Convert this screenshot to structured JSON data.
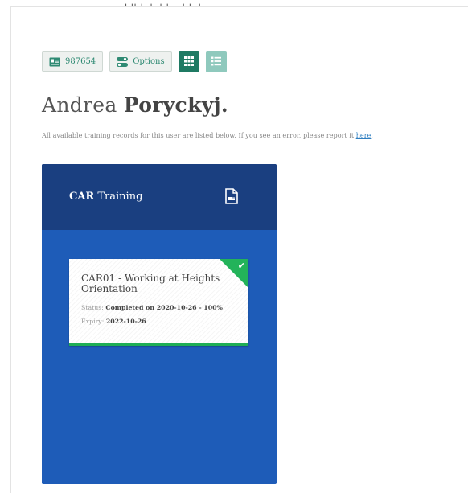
{
  "top_crop_text": "ˌˈˌˌ ˌ ˈˌ ˈˌ ˌˈ ˈ ˌ ˌ ˈˌ ˈ",
  "toolbar": {
    "id_label": "987654",
    "options_label": "Options"
  },
  "user": {
    "first_name": "Andrea",
    "last_name": "Poryckyj."
  },
  "subtitle": {
    "text": "All available training records for this user are listed below. If you see an error, please report it ",
    "link": "here",
    "suffix": "."
  },
  "panel": {
    "title_bold": "CAR",
    "title_rest": " Training",
    "icon": "document-icon"
  },
  "records": [
    {
      "title": "CAR01 - Working at Heights Orientation",
      "status_label": "Status:",
      "status_value": "Completed on 2020-10-26 - 100%",
      "expiry_label": "Expiry:",
      "expiry_value": "2022-10-26",
      "state_icon": "check-icon"
    }
  ],
  "colors": {
    "accent": "#1f7a63",
    "panel_header": "#1a3f80",
    "panel_body": "#1e5cb8",
    "complete": "#23b35a"
  }
}
